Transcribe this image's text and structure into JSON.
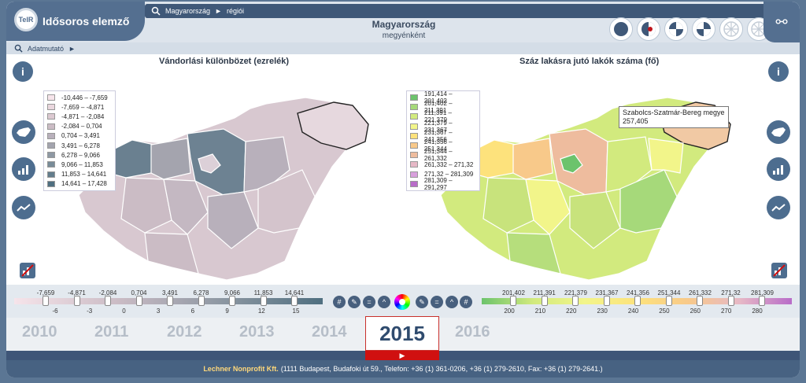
{
  "app": {
    "logo_text": "TeIR",
    "title": "Idősoros elemző"
  },
  "breadcrumb": {
    "root": "Magyarország",
    "sep": "►",
    "leaf": "régiói"
  },
  "region": {
    "title": "Magyarország",
    "subtitle": "megyénként"
  },
  "indicator": {
    "label": "Adatmutató",
    "arrow": "►"
  },
  "left_map": {
    "title": "Vándorlási különbözet (ezrelék)",
    "legend": [
      {
        "range": "-10,446 – -7,659",
        "color": "#f6e4ea"
      },
      {
        "range": "-7,659 – -4,871",
        "color": "#ead7de"
      },
      {
        "range": "-4,871 – -2,084",
        "color": "#dcc9d1"
      },
      {
        "range": "-2,084 – 0,704",
        "color": "#cbbcc5"
      },
      {
        "range": "0,704 – 3,491",
        "color": "#b8b0bb"
      },
      {
        "range": "3,491 – 6,278",
        "color": "#a3a4ae"
      },
      {
        "range": "6,278 – 9,066",
        "color": "#8e98a3"
      },
      {
        "range": "9,066 – 11,853",
        "color": "#788b98"
      },
      {
        "range": "11,853 – 14,641",
        "color": "#637d8c"
      },
      {
        "range": "14,641 – 17,428",
        "color": "#4f6f80"
      }
    ]
  },
  "right_map": {
    "title": "Száz lakásra jutó lakók száma (fő)",
    "legend": [
      {
        "range": "191,414 – 201,402",
        "color": "#6cc36c"
      },
      {
        "range": "201,402 – 211,391",
        "color": "#a6d97a"
      },
      {
        "range": "211,391 – 221,379",
        "color": "#d2ea7e"
      },
      {
        "range": "221,379 – 231,367",
        "color": "#f2f58a"
      },
      {
        "range": "231,367 – 241,356",
        "color": "#fde27c"
      },
      {
        "range": "241,356 – 251,344",
        "color": "#f8c98a"
      },
      {
        "range": "251,344 – 261,332",
        "color": "#eebc9e"
      },
      {
        "range": "261,332 – 271,32",
        "color": "#e6b8c6"
      },
      {
        "range": "271,32 – 281,309",
        "color": "#d8a0dc"
      },
      {
        "range": "281,309 – 291,297",
        "color": "#b86cc8"
      }
    ],
    "tooltip": {
      "name": "Szabolcs-Szatmár-Bereg megye",
      "value": "257,405"
    }
  },
  "left_slider": {
    "top_labels": [
      "-7,659",
      "-4,871",
      "-2,084",
      "0,704",
      "3,491",
      "6,278",
      "9,066",
      "11,853",
      "14,641"
    ],
    "bottom_labels": [
      "-6",
      "-3",
      "0",
      "3",
      "6",
      "9",
      "12",
      "15"
    ]
  },
  "right_slider": {
    "top_labels": [
      "201,402",
      "211,391",
      "221,379",
      "231,367",
      "241,356",
      "251,344",
      "261,332",
      "271,32",
      "281,309"
    ],
    "bottom_labels": [
      "200",
      "210",
      "220",
      "230",
      "240",
      "250",
      "260",
      "270",
      "280"
    ]
  },
  "controls": {
    "hash": "#",
    "equal": "=",
    "up": "^"
  },
  "years": [
    "2010",
    "2011",
    "2012",
    "2013",
    "2014",
    "2015",
    "2016"
  ],
  "selected_year": "2015",
  "footer": {
    "org": "Lechner Nonprofit Kft.",
    "text": "(1111 Budapest, Budafoki út 59., Telefon: +36 (1) 361-0206, +36 (1) 279-2610, Fax: +36 (1) 279-2641.)"
  }
}
